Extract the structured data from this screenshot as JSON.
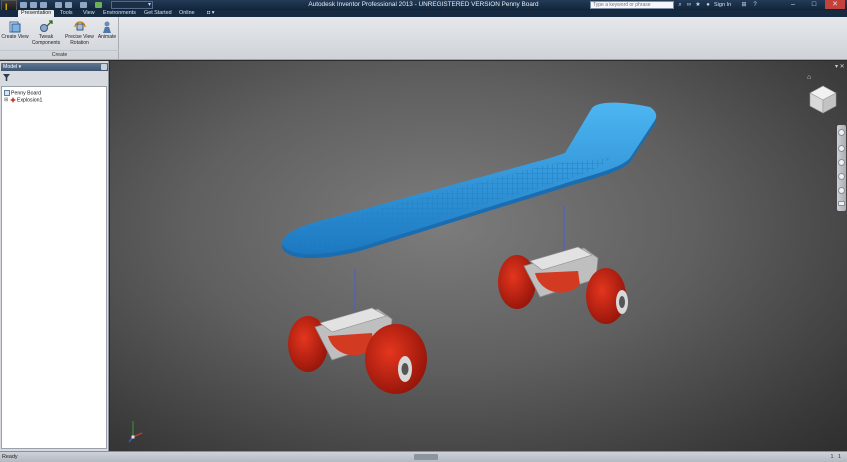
{
  "titlebar": {
    "title": "Autodesk Inventor Professional 2013 - UNREGISTERED VERSION    Penny Board",
    "search_placeholder": "Type a keyword or phrase",
    "sign_in_label": "Sign In",
    "icons": [
      "search-icon",
      "binoculars-icon",
      "star-icon",
      "cart-icon",
      "user-icon",
      "help-icon"
    ]
  },
  "ribbon": {
    "tabs": [
      "Presentation",
      "Tools",
      "View",
      "Environments",
      "Get Started",
      "Online"
    ],
    "active_tab": "Presentation",
    "panel_label": "Create",
    "buttons": [
      {
        "label_lines": [
          "Create View"
        ]
      },
      {
        "label_lines": [
          "Tweak",
          "Components"
        ]
      },
      {
        "label_lines": [
          "Precise View",
          "Rotation"
        ]
      },
      {
        "label_lines": [
          "Animate"
        ]
      }
    ]
  },
  "browser": {
    "header_label": "Model ▾",
    "tree": [
      {
        "label": "Penny Board"
      },
      {
        "label": "Explosion1"
      }
    ]
  },
  "statusbar": {
    "text": "Ready",
    "right_values": [
      "1",
      "1"
    ]
  },
  "colors": {
    "deck": "#2a8fd6",
    "wheels": "#b3170d",
    "trucks": "#c9c9c9",
    "titlebar": "#1b3350",
    "viewport_bg": "#5f5f5f"
  }
}
